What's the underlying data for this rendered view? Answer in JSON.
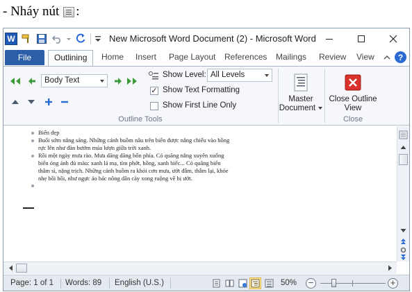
{
  "caption": {
    "text": "- Nháy nút",
    "suffix": ":"
  },
  "window": {
    "title": "New Microsoft Word Document (2)  -  Microsoft Word",
    "app_icon_letter": "W"
  },
  "tabs": {
    "file": "File",
    "items": [
      "Outlining",
      "Home",
      "Insert",
      "Page Layout",
      "References",
      "Mailings",
      "Review",
      "View"
    ],
    "help": "?"
  },
  "ribbon": {
    "outline_tools": {
      "label": "Outline Tools",
      "level_select_value": "Body Text",
      "show_level_label": "Show Level:",
      "show_level_value": "All Levels",
      "show_text_formatting": {
        "label": "Show Text Formatting",
        "checked": true
      },
      "show_first_line_only": {
        "label": "Show First Line Only",
        "checked": false
      }
    },
    "master_document": {
      "label": "Master Document"
    },
    "close_group": {
      "label": "Close",
      "button_label": "Close Outline View"
    }
  },
  "document": {
    "items": [
      "Biển đẹp",
      "Buổi sớm nắng sáng. Những cánh buồm nâu trên biển được nắng chiếu vào hồng rực lên như đàn bướm múa lượn giữa trời xanh.",
      "Rồi một ngày mưa rào. Mưa dăng dăng bốn phía. Có quãng nắng xuyên xuống biển óng ánh đủ màu: xanh lá mạ, tím phớt, hồng, xanh biếc... Có quãng biển thâm sì, nặng trịch. Những cánh buồm ra khỏi cơn mưa, ướt đẫm, thẫm lại, khỏe nhẹ bồi hồi, như ngực áo bác nông dân cày xong ruộng về bị ướt.",
      ""
    ]
  },
  "status": {
    "page": "Page: 1 of 1",
    "words": "Words: 89",
    "language": "English (U.S.)",
    "zoom": "50%",
    "zoom_level_percent": 50
  },
  "colors": {
    "file_tab": "#2a5ea8",
    "close_button": "#d9312b",
    "active_view": "#fce9a6"
  }
}
